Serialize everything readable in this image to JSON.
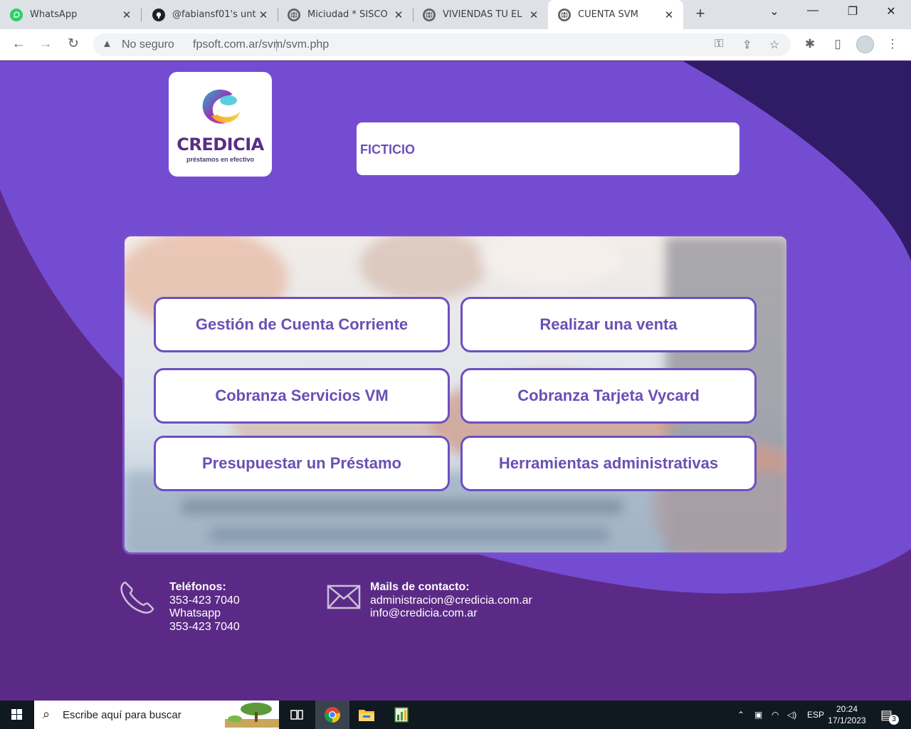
{
  "browser": {
    "tabs": [
      {
        "title": "WhatsApp",
        "icon": "whatsapp-icon"
      },
      {
        "title": "@fabiansf01's unt",
        "icon": "github-icon"
      },
      {
        "title": "Miciudad * SISCO",
        "icon": "globe-icon"
      },
      {
        "title": "VIVIENDAS TU EL",
        "icon": "globe-icon"
      },
      {
        "title": "CUENTA SVM",
        "icon": "globe-icon"
      }
    ],
    "security_label": "No seguro",
    "url": "fpsoft.com.ar/svm/svm.php"
  },
  "logo": {
    "name": "CREDICIA",
    "tagline": "préstamos en efectivo"
  },
  "client": {
    "name": "FICTICIO"
  },
  "menu": {
    "items": [
      {
        "label": "Gestión de Cuenta Corriente"
      },
      {
        "label": "Realizar una venta"
      },
      {
        "label": "Cobranza Servicios VM"
      },
      {
        "label": "Cobranza Tarjeta Vycard"
      },
      {
        "label": "Presupuestar un Préstamo"
      },
      {
        "label": "Herramientas administrativas"
      }
    ]
  },
  "footer": {
    "phones": {
      "heading": "Teléfonos:",
      "lines": [
        "353-423 7040",
        "Whatsapp",
        "353-423 7040"
      ]
    },
    "mails": {
      "heading": "Mails de contacto:",
      "lines": [
        "administracion@credicia.com.ar",
        "info@credicia.com.ar"
      ]
    }
  },
  "taskbar": {
    "search_placeholder": "Escribe aquí para buscar",
    "language": "ESP",
    "time": "20:24",
    "date": "17/1/2023",
    "notification_count": "3"
  },
  "colors": {
    "page_purple_light": "#744cd2",
    "page_purple_dark": "#5b2a86",
    "accent_dark": "#2f1b66",
    "button_text": "#6a4fb5"
  }
}
